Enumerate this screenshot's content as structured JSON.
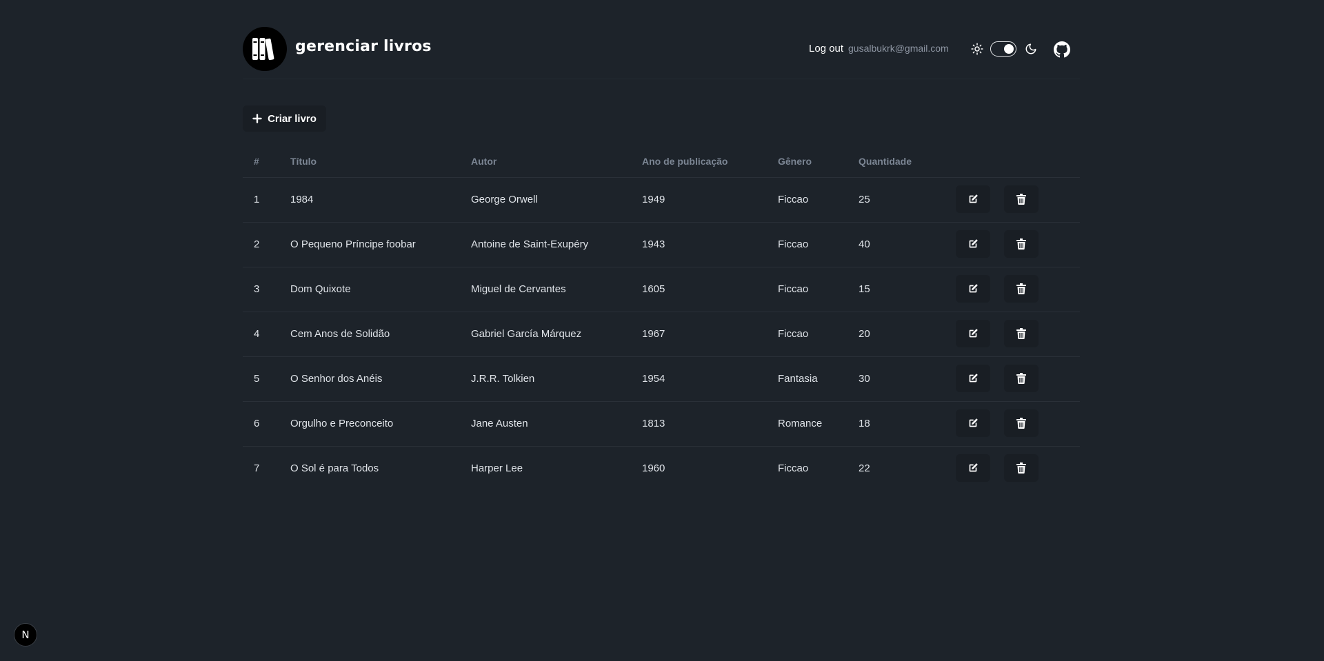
{
  "header": {
    "brand": "gerenciar livros",
    "logout_label": "Log out",
    "email": "gusalbukrk@gmail.com",
    "theme_toggle_on": true
  },
  "toolbar": {
    "create_label": "Criar livro"
  },
  "table": {
    "columns": [
      "#",
      "Título",
      "Autor",
      "Ano de publicação",
      "Gênero",
      "Quantidade"
    ],
    "rows": [
      {
        "id": "1",
        "titulo": "1984",
        "autor": "George Orwell",
        "ano": "1949",
        "genero": "Ficcao",
        "quantidade": "25"
      },
      {
        "id": "2",
        "titulo": "O Pequeno Príncipe foobar",
        "autor": "Antoine de Saint-Exupéry",
        "ano": "1943",
        "genero": "Ficcao",
        "quantidade": "40"
      },
      {
        "id": "3",
        "titulo": "Dom Quixote",
        "autor": "Miguel de Cervantes",
        "ano": "1605",
        "genero": "Ficcao",
        "quantidade": "15"
      },
      {
        "id": "4",
        "titulo": "Cem Anos de Solidão",
        "autor": "Gabriel García Márquez",
        "ano": "1967",
        "genero": "Ficcao",
        "quantidade": "20"
      },
      {
        "id": "5",
        "titulo": "O Senhor dos Anéis",
        "autor": "J.R.R. Tolkien",
        "ano": "1954",
        "genero": "Fantasia",
        "quantidade": "30"
      },
      {
        "id": "6",
        "titulo": "Orgulho e Preconceito",
        "autor": "Jane Austen",
        "ano": "1813",
        "genero": "Romance",
        "quantidade": "18"
      },
      {
        "id": "7",
        "titulo": "O Sol é para Todos",
        "autor": "Harper Lee",
        "ano": "1960",
        "genero": "Ficcao",
        "quantidade": "22"
      }
    ]
  },
  "badge": {
    "letter": "N"
  },
  "icons": {
    "logo": "books-icon",
    "sun": "sun-icon",
    "moon": "moon-icon",
    "github": "github-icon",
    "create": "plus-icon",
    "edit": "edit-icon",
    "delete": "trash-icon"
  },
  "colors": {
    "background": "#1d232a",
    "button_bg": "#191e24",
    "text": "#dfe3e8",
    "header_text": "#7b8593"
  }
}
